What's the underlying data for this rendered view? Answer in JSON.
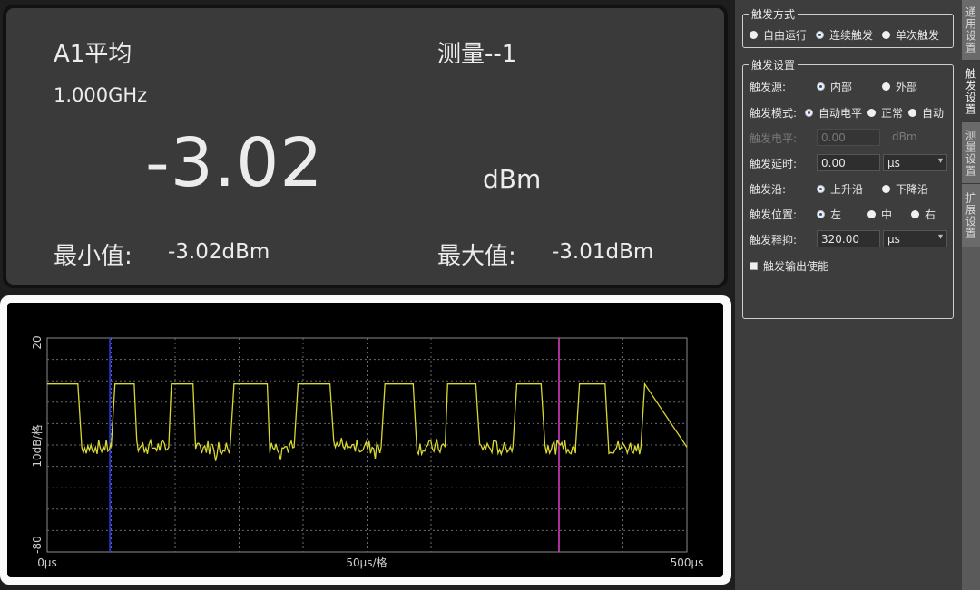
{
  "measurement": {
    "channel": "A1平均",
    "frequency": "1.000GHz",
    "title": "测量--1",
    "value": "-3.02",
    "unit": "dBm",
    "min_label": "最小值:",
    "min_value": "-3.02dBm",
    "max_label": "最大值:",
    "max_value": "-3.01dBm"
  },
  "chart_data": {
    "type": "line",
    "ylabel": "10dB/格",
    "xlabel": "50μs/格",
    "y_top_label": "20",
    "y_bottom_label": "-80",
    "x_left_label": "0μs",
    "x_right_label": "500μs",
    "ylim": [
      -80,
      20
    ],
    "xlim": [
      0,
      500
    ],
    "grid": true,
    "series": [
      {
        "color": "#d8d832",
        "x": [
          0,
          24,
          27,
          50,
          53,
          68,
          70,
          95,
          97,
          114,
          116,
          143,
          146,
          172,
          174,
          193,
          196,
          221,
          224,
          261,
          264,
          286,
          289,
          311,
          313,
          335,
          338,
          364,
          367,
          386,
          389,
          413,
          416,
          436,
          439,
          464,
          467,
          500
        ],
        "values": [
          -1.5,
          -1.5,
          -31,
          -31,
          -1.5,
          -1.5,
          -31,
          -31,
          -1.5,
          -1.5,
          -31,
          -31,
          -1.5,
          -1.5,
          -31,
          -31,
          -1.5,
          -1.5,
          -31,
          -31,
          -1.5,
          -1.5,
          -31,
          -31,
          -1.5,
          -1.5,
          -31,
          -31,
          -1.5,
          -1.5,
          -31,
          -31,
          -1.5,
          -1.5,
          -31,
          -31,
          -1.5,
          -31
        ]
      }
    ],
    "markers": [
      {
        "x": 49,
        "color": "#2a3cff"
      },
      {
        "x": 400,
        "color": "#e040c8"
      }
    ]
  },
  "settings": {
    "trigger_mode_group": {
      "title": "触发方式",
      "options": [
        "自由运行",
        "连续触发",
        "单次触发"
      ],
      "selected": 1
    },
    "trigger_settings_group": {
      "title": "触发设置",
      "source": {
        "label": "触发源:",
        "options": [
          "内部",
          "外部"
        ],
        "selected": 0
      },
      "mode": {
        "label": "触发模式:",
        "options": [
          "自动电平",
          "正常",
          "自动"
        ],
        "selected": 0
      },
      "level": {
        "label": "触发电平:",
        "value": "0.00",
        "unit": "dBm"
      },
      "delay": {
        "label": "触发延时:",
        "value": "0.00",
        "unit": "μs"
      },
      "edge": {
        "label": "触发沿:",
        "options": [
          "上升沿",
          "下降沿"
        ],
        "selected": 0
      },
      "position": {
        "label": "触发位置:",
        "options": [
          "左",
          "中",
          "右"
        ],
        "selected": 0
      },
      "holdoff": {
        "label": "触发释抑:",
        "value": "320.00",
        "unit": "μs"
      },
      "output_enable": "触发输出使能"
    }
  },
  "tabs": [
    {
      "label": "通用设置",
      "active": false
    },
    {
      "label": "触发设置",
      "active": true
    },
    {
      "label": "测量设置",
      "active": false
    },
    {
      "label": "扩展设置",
      "active": false
    }
  ]
}
